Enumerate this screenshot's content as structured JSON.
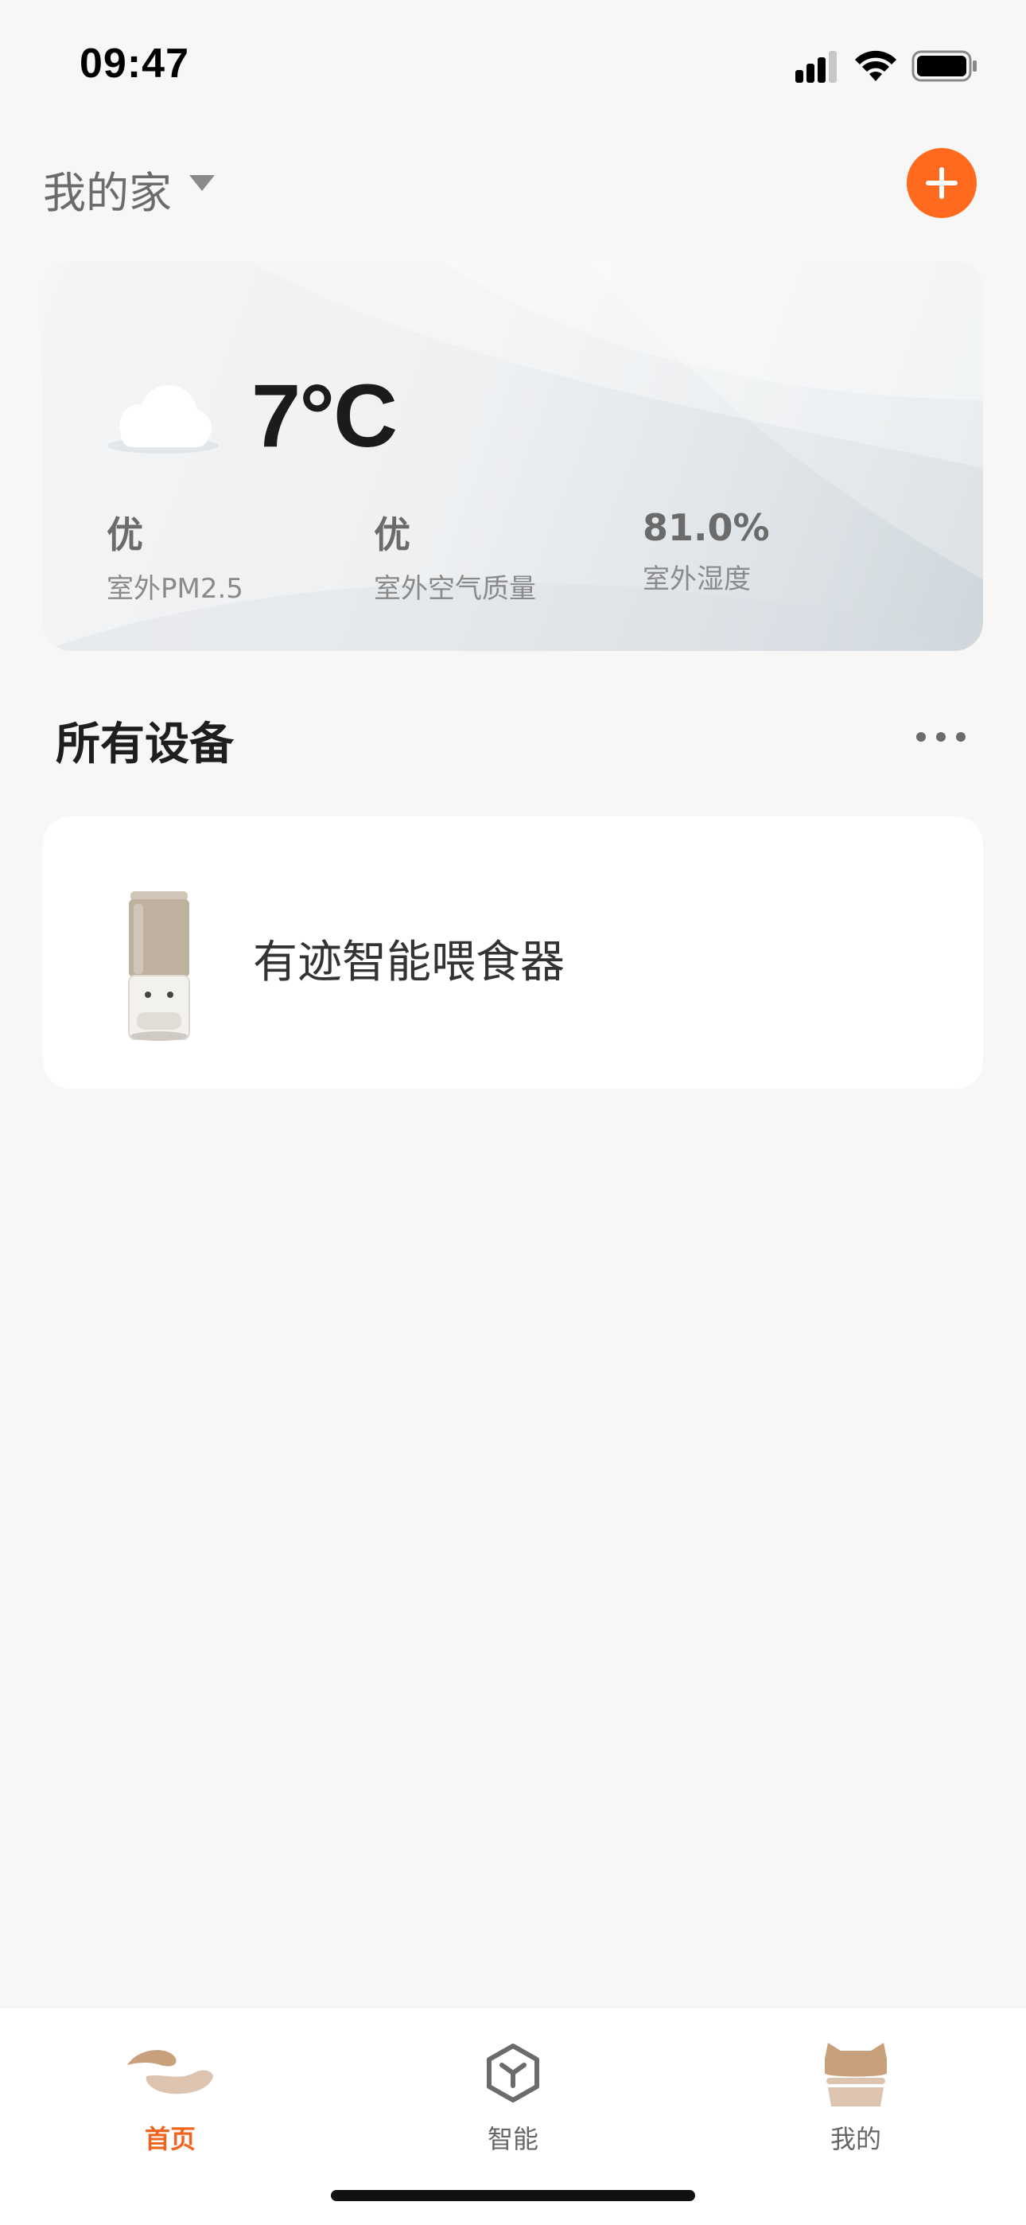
{
  "status_bar": {
    "time": "09:47"
  },
  "header": {
    "home_title": "我的家"
  },
  "weather": {
    "temperature": "7°C",
    "metrics": [
      {
        "value": "优",
        "label": "室外PM2.5"
      },
      {
        "value": "优",
        "label": "室外空气质量"
      },
      {
        "value": "81.0%",
        "label": "室外湿度"
      }
    ]
  },
  "devices_section": {
    "title": "所有设备",
    "devices": [
      {
        "name": "有迹智能喂食器"
      }
    ]
  },
  "tab_bar": {
    "tabs": [
      {
        "label": "首页",
        "active": true,
        "icon": "home-tab-icon"
      },
      {
        "label": "智能",
        "active": false,
        "icon": "cube-icon"
      },
      {
        "label": "我的",
        "active": false,
        "icon": "cat-cup-icon"
      }
    ]
  },
  "colors": {
    "accent": "#ff6a1f",
    "active_tab": "#f0641e"
  }
}
